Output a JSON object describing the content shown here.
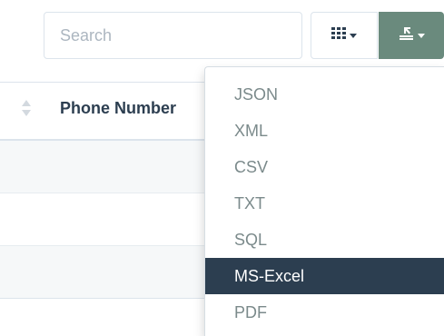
{
  "toolbar": {
    "search_placeholder": "Search",
    "columns_icon": "grid-icon",
    "export_icon": "download-icon",
    "export_button_color": "#6a8a7d"
  },
  "table": {
    "sort_icon": "sort-icon",
    "columns": [
      "Phone Number"
    ],
    "rows": [
      {
        "phone": ""
      },
      {
        "phone": ""
      },
      {
        "phone": ""
      }
    ]
  },
  "export_menu": {
    "items": [
      "JSON",
      "XML",
      "CSV",
      "TXT",
      "SQL",
      "MS-Excel",
      "PDF"
    ],
    "active_item": "MS-Excel",
    "active_color": "#2c3e50"
  }
}
